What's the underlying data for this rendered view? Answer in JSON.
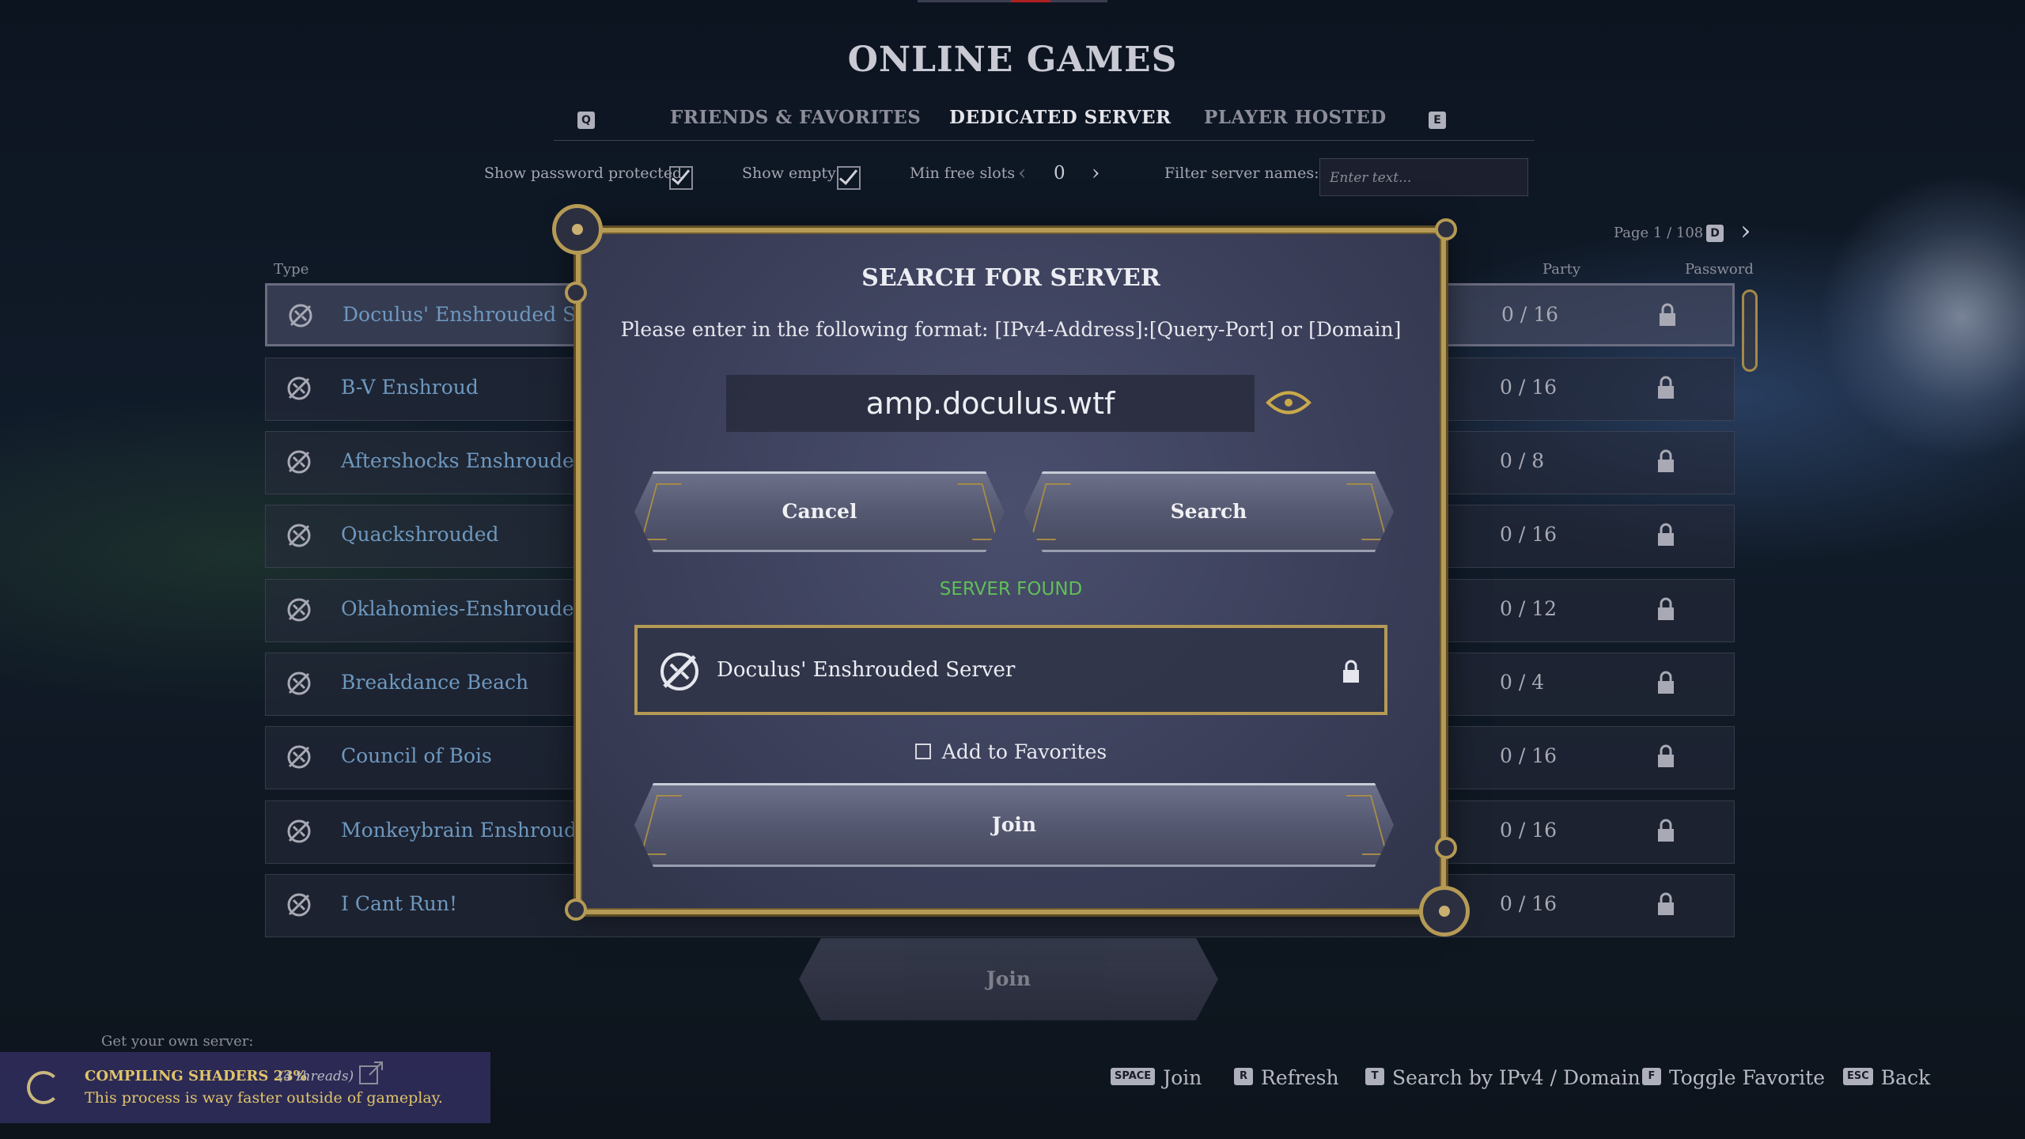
{
  "page_title": "ONLINE GAMES",
  "tabs": {
    "left_key": "Q",
    "right_key": "E",
    "items": [
      {
        "label": "FRIENDS & FAVORITES",
        "active": false
      },
      {
        "label": "DEDICATED SERVER",
        "active": true
      },
      {
        "label": "PLAYER HOSTED",
        "active": false
      }
    ]
  },
  "filters": {
    "show_password_protected": {
      "label": "Show password protected",
      "checked": true
    },
    "show_empty": {
      "label": "Show empty",
      "checked": true
    },
    "min_free_slots": {
      "label": "Min free slots",
      "value": "0"
    },
    "filter_names": {
      "label": "Filter server names:",
      "placeholder": "Enter text..."
    }
  },
  "pagination": {
    "text": "Page 1 / 108",
    "key": "D"
  },
  "columns": {
    "type": "Type",
    "party": "Party",
    "password": "Password"
  },
  "servers": [
    {
      "name": "Doculus' Enshrouded Serv",
      "party": "0 / 16"
    },
    {
      "name": "B-V Enshroud",
      "party": "0 / 16"
    },
    {
      "name": "Aftershocks Enshrouded F",
      "party": "0 / 8"
    },
    {
      "name": "Quackshrouded",
      "party": "0 / 16"
    },
    {
      "name": "Oklahomies-Enshrouded",
      "party": "0 / 12"
    },
    {
      "name": "Breakdance Beach",
      "party": "0 / 4"
    },
    {
      "name": "Council of Bois",
      "party": "0 / 16"
    },
    {
      "name": "Monkeybrain Enshrouded",
      "party": "0 / 16"
    },
    {
      "name": "I Cant Run!",
      "party": "0 / 16"
    }
  ],
  "modal": {
    "title": "SEARCH FOR SERVER",
    "instruction": "Please enter in the following format: [IPv4-Address]:[Query-Port] or [Domain]",
    "address_value": "amp.doculus.wtf",
    "cancel_label": "Cancel",
    "search_label": "Search",
    "status": "SERVER FOUND",
    "found_server_name": "Doculus' Enshrouded Server",
    "add_to_favorites": "Add to Favorites",
    "join_label": "Join"
  },
  "bottom_join_label": "Join",
  "own_server_label": "Get your own server:",
  "compile": {
    "title": "COMPILING SHADERS 23%",
    "threads": "(4 threads)",
    "message": "This process is way faster outside of gameplay."
  },
  "hints": [
    {
      "key": "SPACE",
      "label": "Join"
    },
    {
      "key": "R",
      "label": "Refresh"
    },
    {
      "key": "T",
      "label": "Search by IPv4 / Domain"
    },
    {
      "key": "F",
      "label": "Toggle Favorite"
    },
    {
      "key": "ESC",
      "label": "Back"
    }
  ],
  "colors": {
    "gold": "#b59a55",
    "server_name": "#6e98bf",
    "found": "#5fbf58",
    "compile": "#e0c46a"
  }
}
